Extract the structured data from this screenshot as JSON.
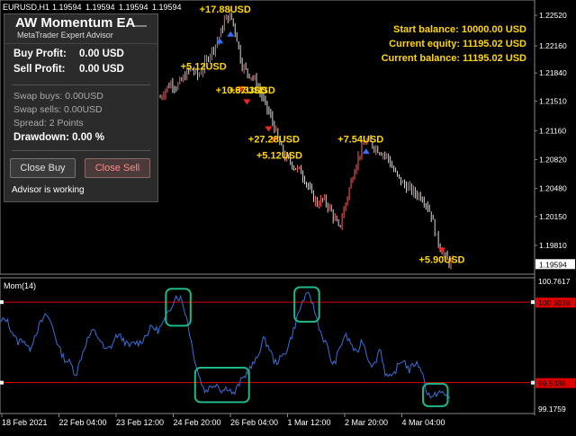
{
  "window": {
    "symbol_label": "EURUSD,H1",
    "quote_values": [
      "1.19594",
      "1.19594",
      "1.19594",
      "1.19594"
    ]
  },
  "panel": {
    "title": "AW Momentum EA",
    "subtitle": "MetaTrader Expert Advisor",
    "minimize_glyph": "—",
    "buy_profit_label": "Buy Profit:",
    "buy_profit_value": "0.00 USD",
    "sell_profit_label": "Sell Profit:",
    "sell_profit_value": "0.00 USD",
    "swap_buys": "Swap buys: 0.00USD",
    "swap_sells": "Swap sells: 0.00USD",
    "spread": "Spread: 2 Points",
    "drawdown": "Drawdown: 0.00 %",
    "close_buy_label": "Close Buy",
    "close_sell_label": "Close Sell",
    "status": "Advisor is working"
  },
  "account": {
    "start_balance": "Start balance: 10000.00 USD",
    "current_equity": "Current equity: 11195.02 USD",
    "current_balance": "Current balance: 11195.02 USD"
  },
  "colors": {
    "background": "#000000",
    "bull_candle": "#ff6060",
    "bear_candle": "#d8d8d8",
    "profit_label": "#ffd700",
    "indicator_line": "#3b6fd6",
    "level_line": "#e00000",
    "highlight_box": "#1fb88a",
    "buy_arrow": "#3070ff",
    "sell_arrow": "#ff2020"
  },
  "chart_data": [
    {
      "type": "candlestick",
      "name": "price",
      "y_ticks": [
        "1.22520",
        "1.22160",
        "1.21840",
        "1.21510",
        "1.21160",
        "1.20820",
        "1.20480",
        "1.20150",
        "1.19810"
      ],
      "ylim": [
        1.1947,
        1.227
      ],
      "current_price": "1.19594",
      "close_path": [
        1.2155,
        1.2165,
        1.2172,
        1.2168,
        1.2175,
        1.2185,
        1.2188,
        1.218,
        1.2192,
        1.2205,
        1.2215,
        1.2228,
        1.2248,
        1.2252,
        1.223,
        1.2195,
        1.2185,
        1.218,
        1.2168,
        1.2152,
        1.2138,
        1.2122,
        1.21,
        1.2085,
        1.208,
        1.2072,
        1.2068,
        1.2055,
        1.204,
        1.203,
        1.2035,
        1.2028,
        1.2015,
        1.2,
        1.2025,
        1.205,
        1.2075,
        1.2092,
        1.2105,
        1.21,
        1.2095,
        1.209,
        1.2085,
        1.207,
        1.206,
        1.2052,
        1.2048,
        1.2042,
        1.204,
        1.2032,
        1.2018,
        1.199,
        1.1975,
        1.1962,
        1.1959
      ],
      "trade_labels": [
        {
          "text": "+17.88USD",
          "x_index": 12,
          "price": 1.2255
        },
        {
          "text": "+5.12USD",
          "x_index": 8,
          "price": 1.2188
        },
        {
          "text": "+10.67USD",
          "x_index": 15,
          "price": 1.216
        },
        {
          "text": "+8.33USD",
          "x_index": 17,
          "price": 1.216
        },
        {
          "text": "+27.28USD",
          "x_index": 21,
          "price": 1.2102
        },
        {
          "text": "+5.12USD",
          "x_index": 22,
          "price": 1.2083
        },
        {
          "text": "+7.54USD",
          "x_index": 37,
          "price": 1.2102
        },
        {
          "text": "+5.90USD",
          "x_index": 52,
          "price": 1.196
        }
      ],
      "buy_arrows": [
        {
          "x_index": 11,
          "price": 1.2222
        },
        {
          "x_index": 13,
          "price": 1.223
        },
        {
          "x_index": 38,
          "price": 1.2092
        }
      ],
      "sell_arrows": [
        {
          "x_index": 15,
          "price": 1.2165
        },
        {
          "x_index": 16,
          "price": 1.215
        },
        {
          "x_index": 20,
          "price": 1.2118
        },
        {
          "x_index": 21,
          "price": 1.2105
        },
        {
          "x_index": 52,
          "price": 1.1975
        }
      ]
    },
    {
      "type": "line",
      "name": "Mom(14)",
      "title": "Mom(14)",
      "y_ticks": [
        "100.7617",
        "100.5036",
        "99.5036",
        "99.1759"
      ],
      "ylim": [
        99.1759,
        100.7617
      ],
      "levels": [
        100.5036,
        99.5036
      ],
      "anchor_values": [
        100.25,
        100.3,
        100.15,
        100.0,
        100.05,
        99.9,
        100.1,
        100.25,
        100.35,
        100.2,
        99.95,
        99.8,
        99.75,
        99.6,
        99.85,
        100.05,
        100.15,
        100.05,
        99.9,
        99.95,
        100.1,
        100.05,
        99.95,
        100.0,
        100.0,
        100.1,
        100.2,
        100.15,
        100.25,
        100.4,
        100.58,
        100.55,
        100.3,
        99.9,
        99.6,
        99.4,
        99.45,
        99.5,
        99.4,
        99.45,
        99.35,
        99.5,
        99.6,
        99.7,
        99.8,
        100.05,
        99.95,
        99.75,
        99.8,
        99.9,
        100.1,
        100.35,
        100.55,
        100.6,
        100.35,
        100.1,
        99.95,
        99.7,
        99.9,
        100.1,
        100.0,
        99.85,
        100.05,
        99.8,
        99.7,
        99.95,
        99.6,
        99.55,
        99.7,
        99.8,
        99.65,
        99.75,
        99.7,
        99.4,
        99.3,
        99.4,
        99.35,
        99.32
      ],
      "highlights": [
        {
          "start_index": 29,
          "end_index": 32
        },
        {
          "start_index": 34,
          "end_index": 42
        },
        {
          "start_index": 51,
          "end_index": 54
        },
        {
          "start_index": 73,
          "end_index": 76
        }
      ]
    }
  ],
  "time_axis": {
    "labels": [
      "18 Feb 2021",
      "22 Feb 04:00",
      "23 Feb 12:00",
      "24 Feb 20:00",
      "26 Feb 04:00",
      "1 Mar 12:00",
      "2 Mar 20:00",
      "4 Mar 04:00"
    ]
  }
}
